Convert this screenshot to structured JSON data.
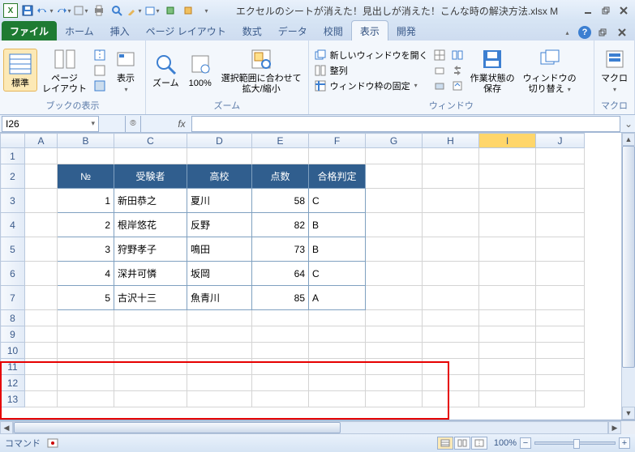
{
  "title": "エクセルのシートが消えた！見出しが消えた！こんな時の解決方法.xlsx M",
  "tabs": {
    "file": "ファイル",
    "home": "ホーム",
    "insert": "挿入",
    "pagelayout": "ページ レイアウト",
    "formulas": "数式",
    "data": "データ",
    "review": "校閲",
    "view": "表示",
    "developer": "開発"
  },
  "ribbon": {
    "group_book_display": "ブックの表示",
    "group_zoom": "ズーム",
    "group_window": "ウィンドウ",
    "group_macro": "マクロ",
    "btn_normal": "標準",
    "btn_page_layout": "ページ\nレイアウト",
    "btn_show": "表示",
    "btn_zoom": "ズーム",
    "btn_100": "100%",
    "btn_fit_selection": "選択範囲に合わせて\n拡大/縮小",
    "btn_new_window": "新しいウィンドウを開く",
    "btn_arrange": "整列",
    "btn_freeze": "ウィンドウ枠の固定",
    "btn_save_workspace": "作業状態の\n保存",
    "btn_switch_windows": "ウィンドウの\n切り替え",
    "btn_macros": "マクロ"
  },
  "namebox": "I26",
  "rows": [
    1,
    2,
    3,
    4,
    5,
    6,
    7,
    8,
    9,
    10,
    11,
    12,
    13
  ],
  "cols": [
    "A",
    "B",
    "C",
    "D",
    "E",
    "F",
    "G",
    "H",
    "I",
    "J"
  ],
  "table": {
    "headers": [
      "№",
      "受験者",
      "高校",
      "点数",
      "合格判定"
    ],
    "data": [
      {
        "no": 1,
        "name": "新田恭之",
        "school": "夏川",
        "score": 58,
        "result": "C"
      },
      {
        "no": 2,
        "name": "根岸悠花",
        "school": "反野",
        "score": 82,
        "result": "B"
      },
      {
        "no": 3,
        "name": "狩野孝子",
        "school": "鳴田",
        "score": 73,
        "result": "B"
      },
      {
        "no": 4,
        "name": "深井可憐",
        "school": "坂岡",
        "score": 64,
        "result": "C"
      },
      {
        "no": 5,
        "name": "古沢十三",
        "school": "魚青川",
        "score": 85,
        "result": "A"
      }
    ]
  },
  "status": {
    "mode": "コマンド",
    "zoom": "100%"
  },
  "selected_col": "I"
}
